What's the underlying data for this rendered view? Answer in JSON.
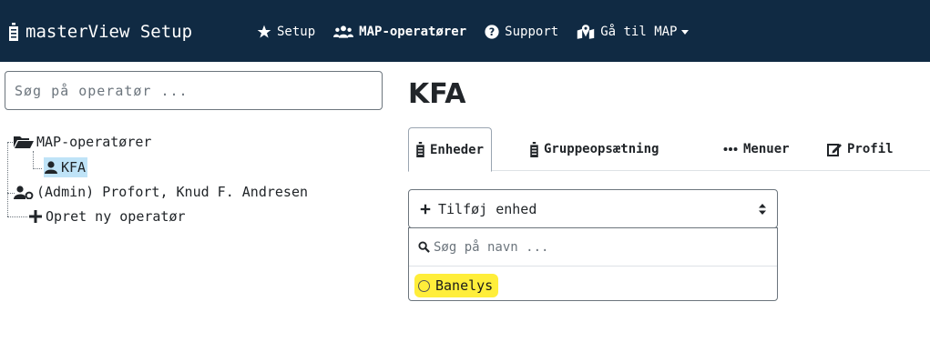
{
  "navbar": {
    "brand": "masterView Setup",
    "items": [
      {
        "label": "Setup",
        "icon": "star-icon"
      },
      {
        "label": "MAP-operatører",
        "icon": "users-icon"
      },
      {
        "label": "Support",
        "icon": "question-circle-icon"
      },
      {
        "label": "Gå til MAP",
        "icon": "map-marker-icon"
      }
    ]
  },
  "sidebar": {
    "search_placeholder": "Søg på operatør ...",
    "tree": {
      "root_label": "MAP-operatører",
      "selected_child": "KFA",
      "admin_label": "(Admin) Profort, Knud F. Andresen",
      "create_label": "Opret ny operatør"
    }
  },
  "main": {
    "title": "KFA",
    "tabs": [
      {
        "label": "Enheder"
      },
      {
        "label": "Gruppeopsætning"
      },
      {
        "label": "Menuer"
      },
      {
        "label": "Profil"
      }
    ],
    "add_unit_label": "Tilføj enhed",
    "menu_search_placeholder": "Søg på navn ...",
    "option_label": "Banelys"
  },
  "colors": {
    "navbar_bg": "#102a43",
    "selection_bg": "#bfe3f7",
    "highlight": "#ffee3a"
  }
}
